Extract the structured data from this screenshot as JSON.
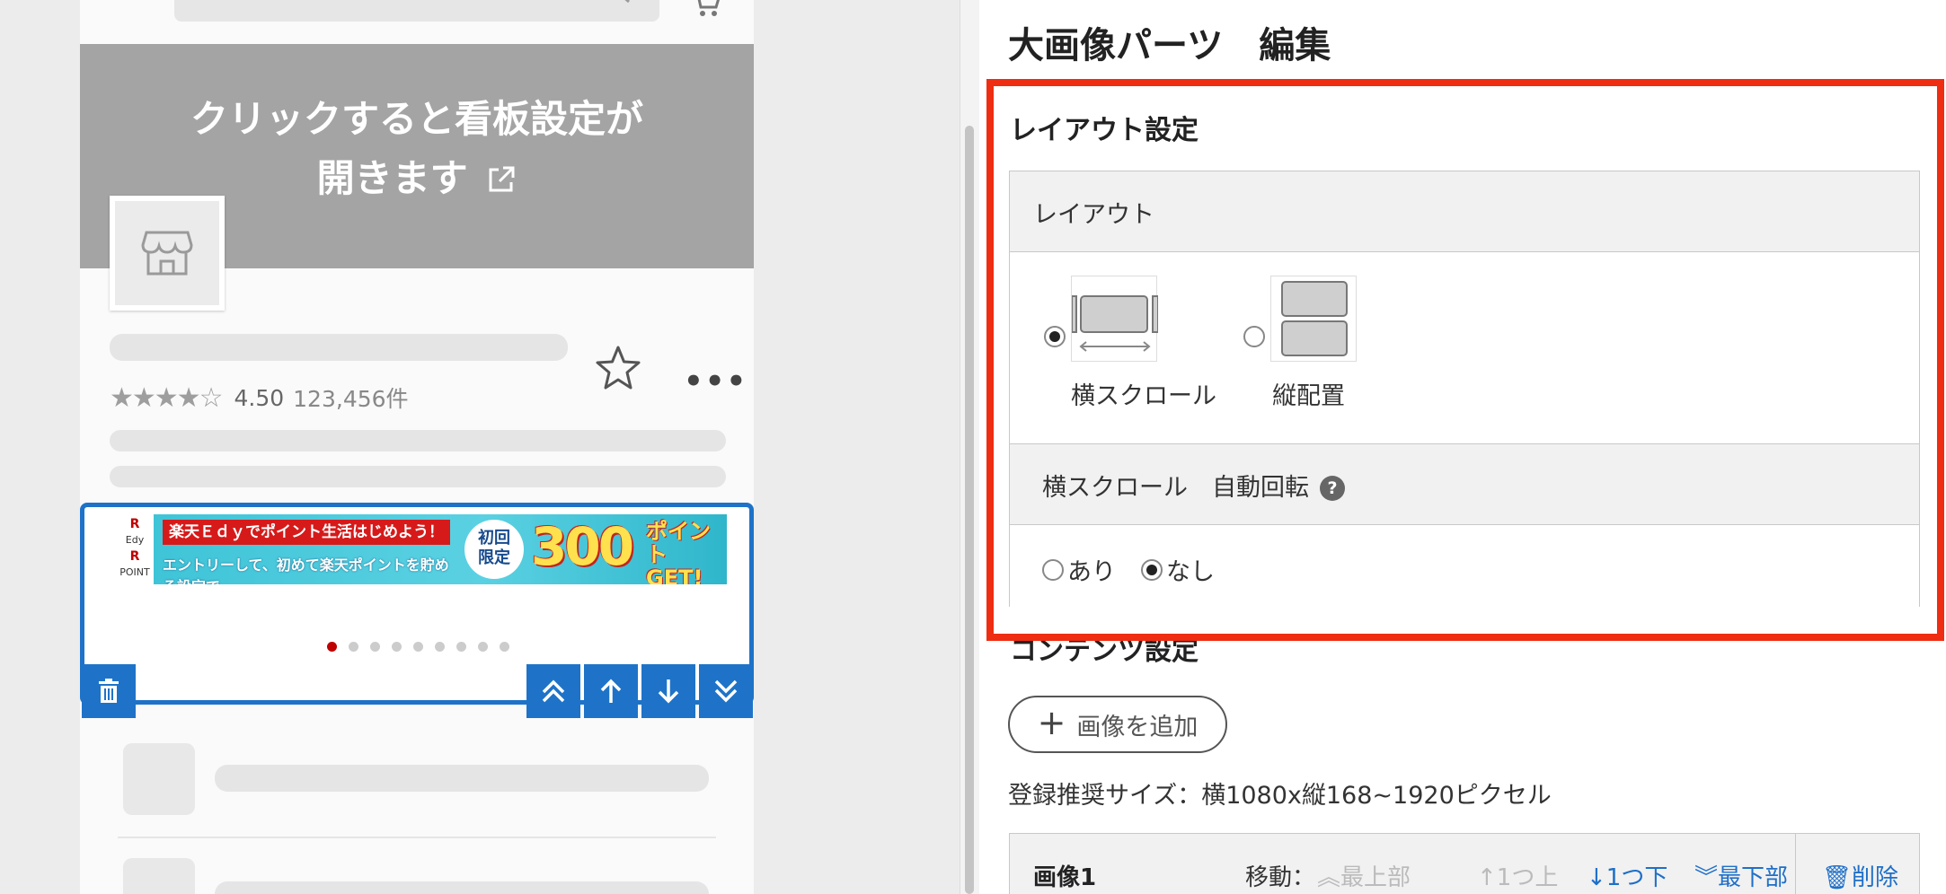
{
  "preview": {
    "banner_line1": "クリックすると看板設定が",
    "banner_line2": "開きます",
    "stars": "★★★★☆",
    "rating_value": "4.50",
    "review_count": "123,456件",
    "more": "•••",
    "ad": {
      "brand_r": "R",
      "brand_edy": "Edy",
      "brand_point": "POINT",
      "headline": "楽天Ｅｄｙでポイント生活はじめよう！",
      "subline": "エントリーして、初めて楽天ポイントを貯める設定で",
      "first_time_1": "初回",
      "first_time_2": "限定",
      "points": "300",
      "get_1": "ポイント",
      "get_2": "GET!"
    },
    "carousel_dot_count": 9,
    "carousel_active_index": 0
  },
  "editor": {
    "title": "大画像パーツ　編集",
    "layout_section": {
      "heading": "レイアウト設定",
      "layout_label": "レイアウト",
      "option_horizontal": "横スクロール",
      "option_vertical": "縦配置",
      "selected": "horizontal",
      "auto_rotate_label": "横スクロール　自動回転",
      "help": "?",
      "auto_yes": "あり",
      "auto_no": "なし",
      "auto_selected": "no"
    },
    "content_section": {
      "heading": "コンテンツ設定",
      "add_image": "画像を追加",
      "recommend_size": "登録推奨サイズ：横1080x縦168~1920ピクセル",
      "images": [
        {
          "name": "画像1",
          "move_label": "移動：",
          "to_top": "最上部",
          "up_one": "1つ上",
          "down_one": "1つ下",
          "to_bottom": "最下部",
          "delete": "削除"
        }
      ]
    }
  },
  "colors": {
    "accent_blue": "#1e73c8",
    "highlight_red": "#ee2d12",
    "banner_gray": "#a4a4a4",
    "link_blue": "#1e6fc8"
  }
}
